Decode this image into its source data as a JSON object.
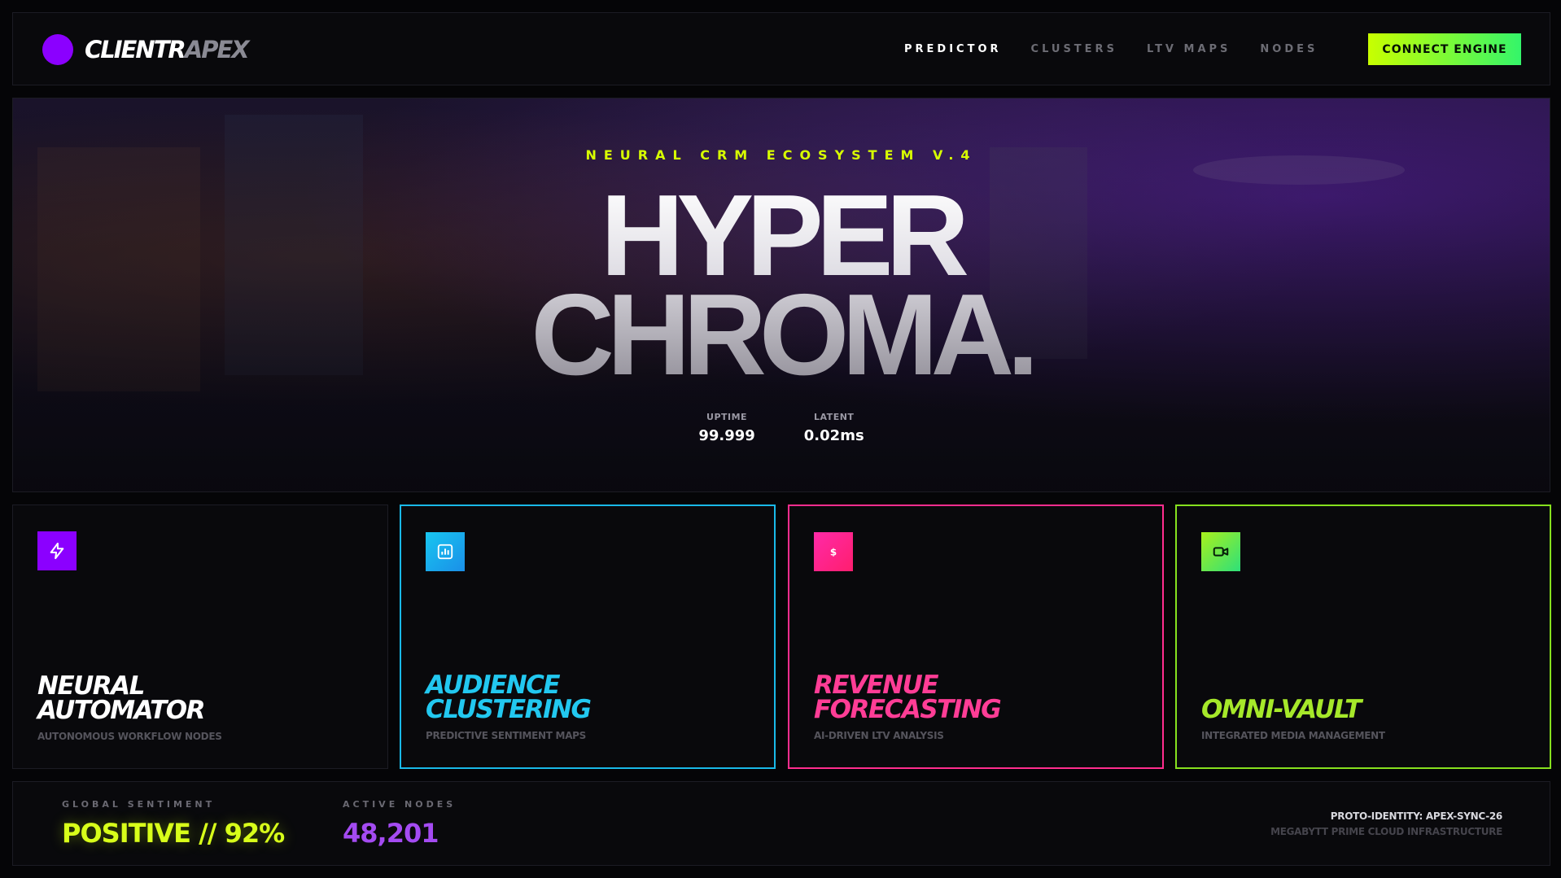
{
  "brand": {
    "name_primary": "CLIENTR",
    "name_secondary": "APEX",
    "accent": "#8b00ff"
  },
  "nav": {
    "links": [
      {
        "label": "PREDICTOR",
        "active": true
      },
      {
        "label": "CLUSTERS",
        "active": false
      },
      {
        "label": "LTV MAPS",
        "active": false
      },
      {
        "label": "NODES",
        "active": false
      }
    ],
    "cta_label": "CONNECT ENGINE"
  },
  "hero": {
    "kicker": "NEURAL CRM ECOSYSTEM V.4",
    "title_line1": "HYPER",
    "title_line2": "CHROMA.",
    "stats": [
      {
        "label": "UPTIME",
        "value": "99.999"
      },
      {
        "label": "LATENT",
        "value": "0.02ms"
      }
    ]
  },
  "cards": [
    {
      "icon": "lightning-icon",
      "title_line1": "NEURAL",
      "title_line2": "AUTOMATOR",
      "subtitle": "AUTONOMOUS WORKFLOW NODES",
      "color": "#ffffff",
      "icon_bg": "#8b00ff"
    },
    {
      "icon": "bar-chart-icon",
      "title_line1": "AUDIENCE",
      "title_line2": "CLUSTERING",
      "subtitle": "PREDICTIVE SENTIMENT MAPS",
      "color": "#22c8f0",
      "icon_bg": "#1aa9ec"
    },
    {
      "icon": "dollar-icon",
      "title_line1": "REVENUE",
      "title_line2": "FORECASTING",
      "subtitle": "AI-DRIVEN LTV ANALYSIS",
      "color": "#ff3d96",
      "icon_bg": "#ff1ea0"
    },
    {
      "icon": "video-camera-icon",
      "title_line1": "",
      "title_line2": "OMNI-VAULT",
      "subtitle": "INTEGRATED MEDIA MANAGEMENT",
      "color": "#a6e82a",
      "icon_bg": "#3de86a"
    }
  ],
  "footer": {
    "sentiment_label": "GLOBAL SENTIMENT",
    "sentiment_value": "POSITIVE // 92%",
    "nodes_label": "ACTIVE NODES",
    "nodes_value": "48,201",
    "identity": "PROTO-IDENTITY: APEX-SYNC-26",
    "infra": "MEGABYTT PRIME CLOUD INFRASTRUCTURE"
  }
}
